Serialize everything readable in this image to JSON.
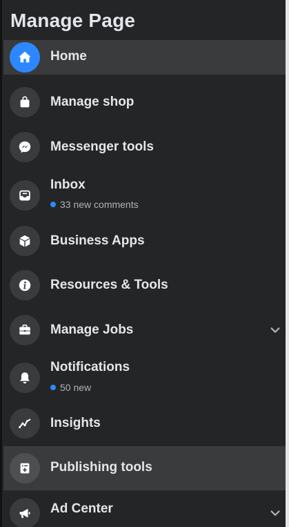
{
  "header": {
    "title": "Manage Page"
  },
  "nav": {
    "items": [
      {
        "label": "Home",
        "icon": "home-icon",
        "active": true
      },
      {
        "label": "Manage shop",
        "icon": "shopping-bag-icon"
      },
      {
        "label": "Messenger tools",
        "icon": "messenger-icon"
      },
      {
        "label": "Inbox",
        "icon": "inbox-icon",
        "subtitle": "33 new comments"
      },
      {
        "label": "Business Apps",
        "icon": "cube-icon"
      },
      {
        "label": "Resources & Tools",
        "icon": "info-icon"
      },
      {
        "label": "Manage Jobs",
        "icon": "briefcase-icon",
        "expandable": true
      },
      {
        "label": "Notifications",
        "icon": "bell-icon",
        "subtitle": "50 new"
      },
      {
        "label": "Insights",
        "icon": "line-chart-icon"
      },
      {
        "label": "Publishing tools",
        "icon": "publishing-icon",
        "active": true
      },
      {
        "label": "Ad Center",
        "icon": "megaphone-icon",
        "expandable": true
      }
    ]
  },
  "colors": {
    "background": "#242526",
    "active_row": "#3a3b3c",
    "accent": "#2d88ff",
    "text_primary": "#e4e6eb",
    "text_secondary": "#b0b3b8"
  }
}
